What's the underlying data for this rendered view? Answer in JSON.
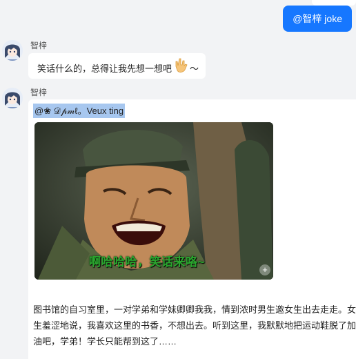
{
  "chat": {
    "user_message": "@智梓 joke",
    "messages": [
      {
        "sender": "智梓",
        "text": "笑话什么的，总得让我先想一想吧",
        "emoji": "rock-hand-emoji",
        "tail": "～"
      },
      {
        "sender": "智梓",
        "mention": "@❀ 𝒟𝓅𝓂ℓ。Veux ting",
        "image_caption": "啊哈哈哈，笑话来咯~",
        "story": "图书馆的自习室里，一对学弟和学妹卿卿我我，情到浓时男生邀女生出去走走。女生羞涩地说，我喜欢这里的书香，不想出去。听到这里，我默默地把运动鞋脱了加油吧，学弟！学长只能帮到这了……"
      }
    ]
  },
  "colors": {
    "accent": "#1677ff",
    "mention_highlight": "#a7c7ef",
    "caption_green": "#2aa52e"
  }
}
